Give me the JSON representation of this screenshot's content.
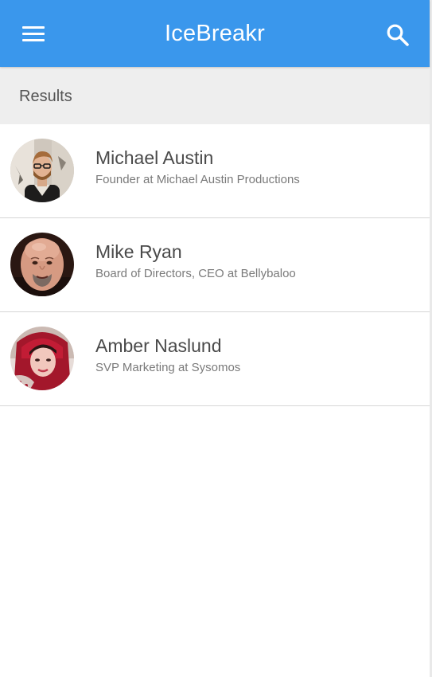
{
  "appbar": {
    "title": "IceBreakr",
    "menu_icon": "hamburger-menu-icon",
    "search_icon": "search-icon",
    "background_color": "#3a97ec"
  },
  "subheader": {
    "title": "Results",
    "background_color": "#eeeeee"
  },
  "results": [
    {
      "name": "Michael Austin",
      "title": "Founder at Michael Austin Productions",
      "avatar_icon": "profile-photo-avatar"
    },
    {
      "name": "Mike Ryan",
      "title": "Board of Directors, CEO at Bellybaloo",
      "avatar_icon": "profile-photo-avatar"
    },
    {
      "name": "Amber Naslund",
      "title": "SVP Marketing at Sysomos",
      "avatar_icon": "profile-photo-avatar"
    }
  ]
}
